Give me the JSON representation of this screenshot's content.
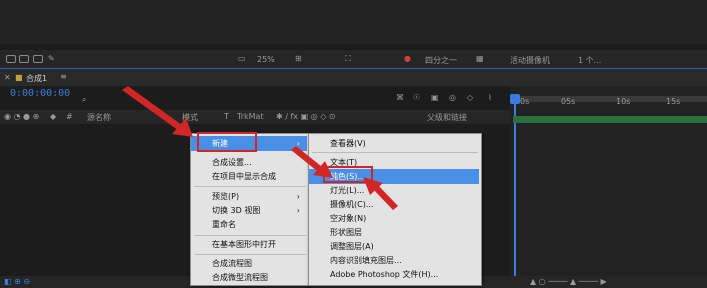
{
  "toolbar": {
    "zoom": "25%",
    "resolution": "四分之一",
    "camera": "活动摄像机",
    "views": "1 个..."
  },
  "comp": {
    "tab_name": "合成1",
    "timecode": "0:00:00:00"
  },
  "columns": {
    "source_name": "源名称",
    "mode": "模式",
    "t": "T",
    "trkmat": "TrkMat",
    "parent": "父级和链接"
  },
  "ruler": [
    "0s",
    "05s",
    "10s",
    "15s"
  ],
  "main_menu": {
    "items": [
      {
        "label": "新建",
        "has_submenu": true,
        "highlighted": true
      },
      {
        "label": "合成设置...",
        "has_submenu": false
      },
      {
        "label": "在项目中显示合成",
        "has_submenu": false
      },
      {
        "label": "预览(P)",
        "has_submenu": true
      },
      {
        "label": "切换 3D 视图",
        "has_submenu": true
      },
      {
        "label": "重命名",
        "has_submenu": false
      },
      {
        "label": "在基本图形中打开",
        "has_submenu": false
      },
      {
        "label": "合成流程图",
        "has_submenu": false
      },
      {
        "label": "合成微型流程图",
        "has_submenu": false
      }
    ]
  },
  "sub_menu": {
    "items": [
      {
        "label": "查看器(V)"
      },
      {
        "label": "文本(T)"
      },
      {
        "label": "纯色(S)...",
        "highlighted": true
      },
      {
        "label": "灯光(L)..."
      },
      {
        "label": "摄像机(C)..."
      },
      {
        "label": "空对象(N)"
      },
      {
        "label": "形状图层"
      },
      {
        "label": "调整图层(A)"
      },
      {
        "label": "内容识别填充图层..."
      },
      {
        "label": "Adobe Photoshop 文件(H)..."
      }
    ]
  },
  "colors": {
    "highlight": "#4a8fe6",
    "annotation_red": "#d12626",
    "timecode_blue": "#3a7ce0"
  }
}
